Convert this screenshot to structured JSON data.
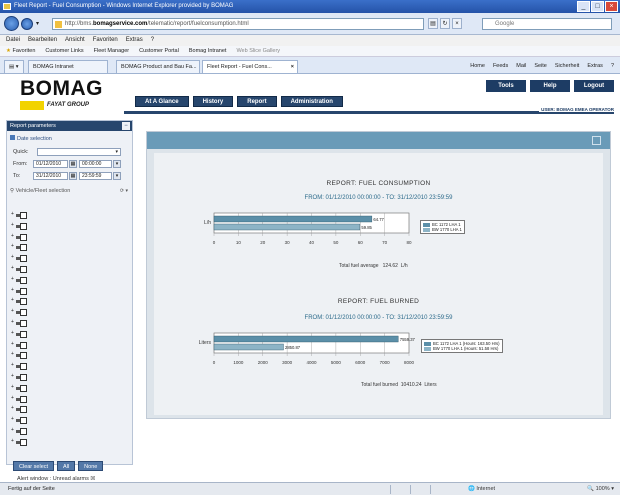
{
  "browser": {
    "title": "Fleet Report - Fuel Consumption - Windows Internet Explorer provided by BOMAG",
    "url_prefix": "http://bms.",
    "url_domain": "bomagservice.com",
    "url_rest": "/telematic/report/fuelconsumption.html",
    "search_placeholder": "Google",
    "menu": [
      "Datei",
      "Bearbeiten",
      "Ansicht",
      "Favoriten",
      "Extras",
      "?"
    ],
    "favorites": [
      "Favoriten",
      "Customer Links",
      "Fleet Manager",
      "Customer Portal",
      "Bomag Intranet",
      "Web Slice Gallery"
    ],
    "tabs": [
      "BOMAG Intranet",
      "BOMAG Product and Bau Fa...",
      "Fleet Report - Fuel Cons..."
    ],
    "commands": [
      "Home",
      "Feeds",
      "Mail",
      "Seite",
      "Sicherheit",
      "Extras",
      "?"
    ]
  },
  "app": {
    "logo": "BOMAG",
    "logo_sub": "FAYAT GROUP",
    "nav": [
      "At A Glance",
      "History",
      "Report",
      "Administration"
    ],
    "right_nav": [
      "Tools",
      "Help",
      "Logout"
    ],
    "user": "USER: BOMAG EMEA OPERATOR"
  },
  "sidebar": {
    "title": "Report parameters",
    "date_section": "Date selection",
    "quick_label": "Quick:",
    "from_label": "From:",
    "from_date": "01/12/2010",
    "from_time": "00:00:00",
    "to_label": "To:",
    "to_date": "31/12/2010",
    "to_time": "23:59:59",
    "vehicle_section": "Vehicle/Fleet selection",
    "vehicle_rows": 22,
    "buttons": [
      "Clear select",
      "All",
      "None"
    ],
    "alert": "Alert window : Unread alarms"
  },
  "report1": {
    "title": "REPORT: FUEL CONSUMPTION",
    "subtitle": "FROM: 01/12/2010 00:00:00 - TO: 31/12/2010 23:59:59",
    "unit": "L/h",
    "total_label": "Total fuel average",
    "total_value": "124.62",
    "total_unit": "L/h"
  },
  "report2": {
    "title": "REPORT: FUEL BURNED",
    "subtitle": "FROM: 01/12/2010 00:00:00 - TO: 31/12/2010 23:59:59",
    "unit": "Liters",
    "total_label": "Total fuel burned",
    "total_value": "10410.24",
    "total_unit": "Liters"
  },
  "status": {
    "left": "Fertig auf der Seite",
    "zone": "Internet",
    "zoom": "100%"
  },
  "chart_data": [
    {
      "type": "bar",
      "orientation": "horizontal",
      "title": "REPORT: FUEL CONSUMPTION",
      "categories": [
        "L/h"
      ],
      "series": [
        {
          "name": "BC 1172 LHA 1",
          "values": [
            64.77
          ],
          "color": "#5b8fa8"
        },
        {
          "name": "BW 1770 LHA 1",
          "values": [
            59.85
          ],
          "color": "#8db4c6"
        }
      ],
      "xlim": [
        0,
        80
      ],
      "xticks": [
        0,
        10,
        20,
        30,
        40,
        50,
        60,
        70,
        80
      ]
    },
    {
      "type": "bar",
      "orientation": "horizontal",
      "title": "REPORT: FUEL BURNED",
      "categories": [
        "Liters"
      ],
      "series": [
        {
          "name": "BC 1172 LHA 1 (Hours: 163.50 Hrs)",
          "values": [
            7559.37
          ],
          "color": "#5b8fa8"
        },
        {
          "name": "BW 1770 LHA 1 (Hours: 51.58 Hrs)",
          "values": [
            2850.87
          ],
          "color": "#8db4c6"
        }
      ],
      "xlim": [
        0,
        8000
      ],
      "xticks": [
        0,
        1000,
        2000,
        3000,
        4000,
        5000,
        6000,
        7000,
        8000
      ]
    }
  ]
}
